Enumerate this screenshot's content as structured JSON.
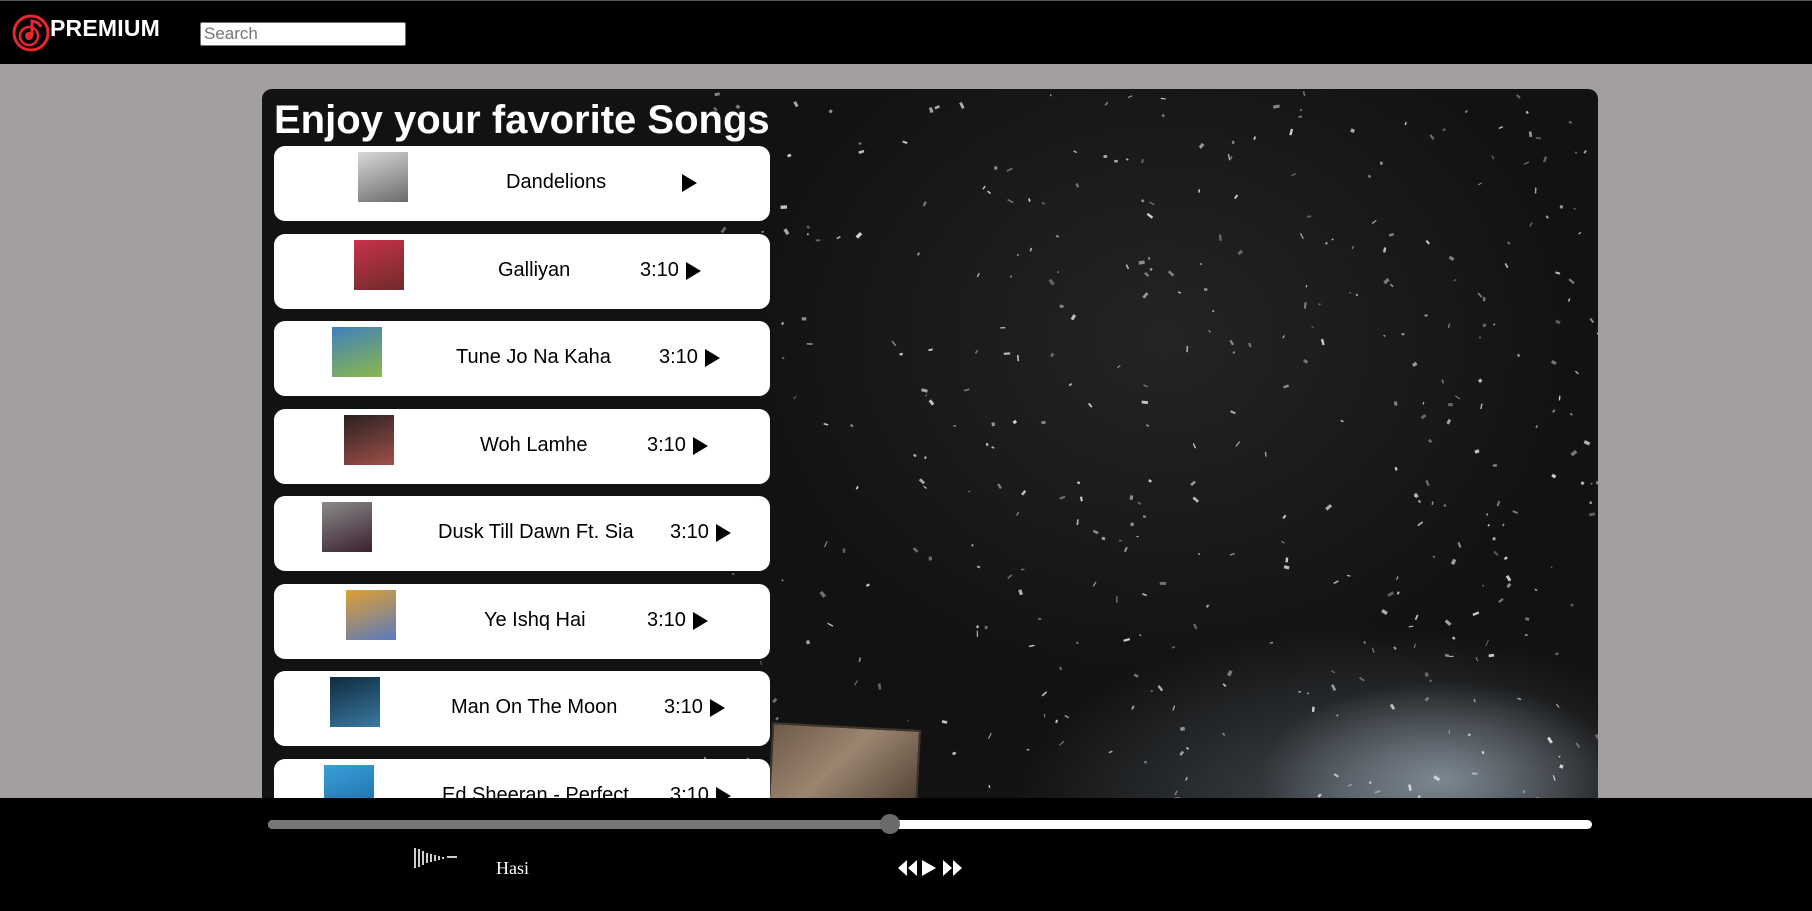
{
  "header": {
    "brand": "PREMIUM",
    "logo_icon": "music-note-logo-icon",
    "search_placeholder": "Search",
    "search_value": ""
  },
  "main": {
    "title": "Enjoy your favorite Songs",
    "songs": [
      {
        "name": "Dandelions",
        "duration": "",
        "thumb_colors": [
          "#d8d8d8",
          "#6b6b6b"
        ]
      },
      {
        "name": "Galliyan",
        "duration": "3:10",
        "thumb_colors": [
          "#c8324a",
          "#6e2b2b"
        ]
      },
      {
        "name": "Tune Jo Na Kaha",
        "duration": "3:10",
        "thumb_colors": [
          "#3f7fbf",
          "#8bb84a"
        ]
      },
      {
        "name": "Woh Lamhe",
        "duration": "3:10",
        "thumb_colors": [
          "#2a2020",
          "#a0504a"
        ]
      },
      {
        "name": "Dusk Till Dawn Ft. Sia",
        "duration": "3:10",
        "thumb_colors": [
          "#8a8a8a",
          "#3a2030"
        ]
      },
      {
        "name": "Ye Ishq Hai",
        "duration": "3:10",
        "thumb_colors": [
          "#e0a030",
          "#5a7ac0"
        ]
      },
      {
        "name": "Man On The Moon",
        "duration": "3:10",
        "thumb_colors": [
          "#0f2a40",
          "#3a7aa0"
        ]
      },
      {
        "name": "Ed Sheeran - Perfect",
        "duration": "3:10",
        "thumb_colors": [
          "#3aa0d8",
          "#1a6aa0"
        ]
      }
    ]
  },
  "player": {
    "progress": 0.47,
    "now_playing": "Hasi",
    "controls": [
      "backward-icon",
      "play-icon",
      "forward-icon"
    ]
  },
  "colors": {
    "page_background": "#a39f9f",
    "bar_background": "#000000",
    "accent_logo": "#e8282d"
  }
}
